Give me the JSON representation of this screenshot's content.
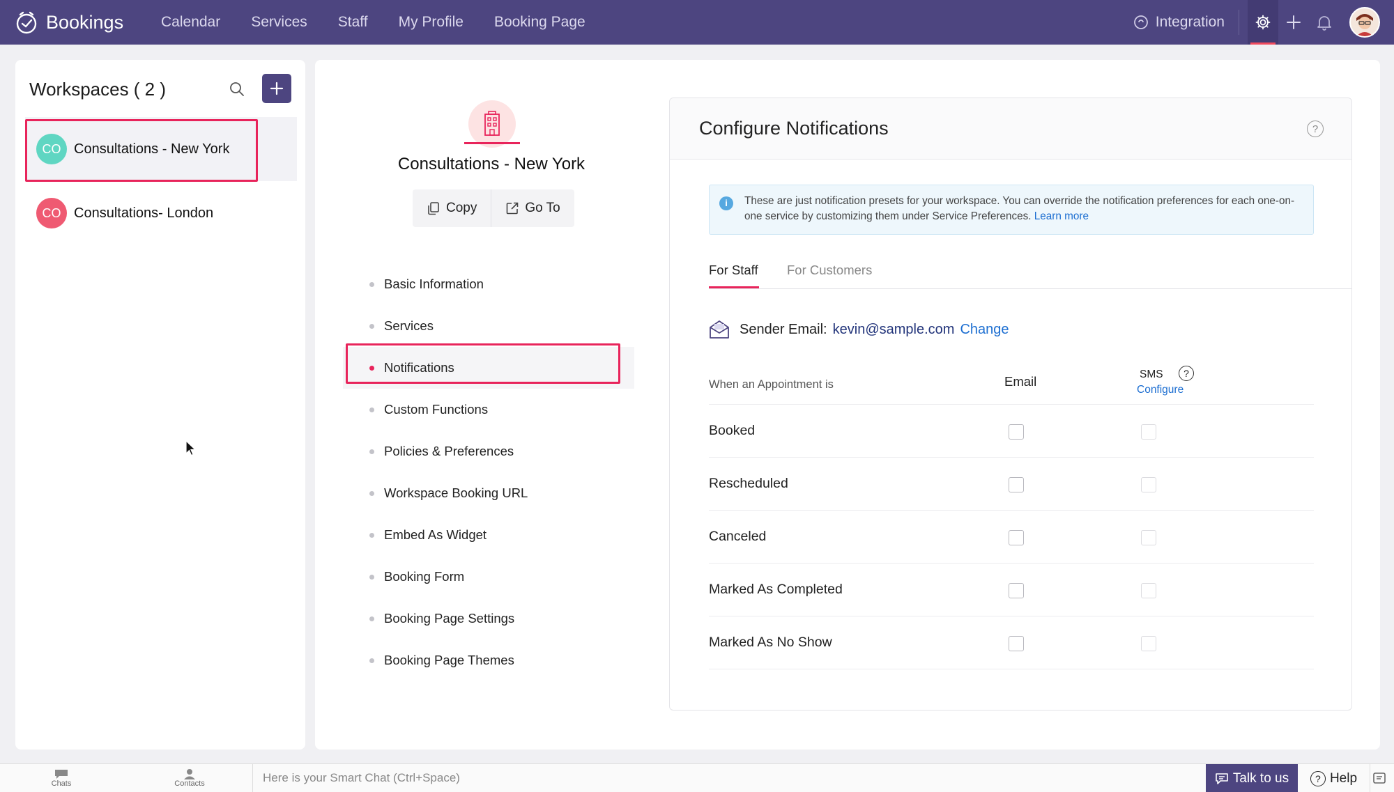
{
  "app": {
    "name": "Bookings",
    "nav": [
      "Calendar",
      "Services",
      "Staff",
      "My Profile",
      "Booking Page"
    ],
    "integration_label": "Integration"
  },
  "workspaces": {
    "title": "Workspaces ( 2 )",
    "items": [
      {
        "initials": "CO",
        "name": "Consultations - New York",
        "color": "#5fd6c2",
        "selected": true
      },
      {
        "initials": "CO",
        "name": "Consultations- London",
        "color": "#ef5a72",
        "selected": false
      }
    ]
  },
  "workspace_detail": {
    "title": "Consultations - New York",
    "copy_label": "Copy",
    "goto_label": "Go To",
    "menu": [
      "Basic Information",
      "Services",
      "Notifications",
      "Custom Functions",
      "Policies & Preferences",
      "Workspace Booking URL",
      "Embed As Widget",
      "Booking Form",
      "Booking Page Settings",
      "Booking Page Themes"
    ],
    "active_menu": "Notifications"
  },
  "notifications": {
    "title": "Configure Notifications",
    "help": "?",
    "info_text": "These are just notification presets for your workspace. You can override the notification preferences for each one-on-one service by customizing them under Service Preferences.",
    "learn_more": "Learn more",
    "tabs": [
      "For Staff",
      "For Customers"
    ],
    "active_tab": "For Staff",
    "sender_label": "Sender Email:",
    "sender_email": "kevin@sample.com",
    "change_label": "Change",
    "col_when": "When an Appointment is",
    "col_email": "Email",
    "col_sms": "SMS",
    "col_sms_help": "?",
    "col_sms_configure": "Configure",
    "rows": [
      "Booked",
      "Rescheduled",
      "Canceled",
      "Marked As Completed",
      "Marked As No Show"
    ]
  },
  "bottom": {
    "chats": "Chats",
    "contacts": "Contacts",
    "smart_chat_placeholder": "Here is your Smart Chat (Ctrl+Space)",
    "talk": "Talk to us",
    "help": "Help",
    "help_icon": "?"
  }
}
